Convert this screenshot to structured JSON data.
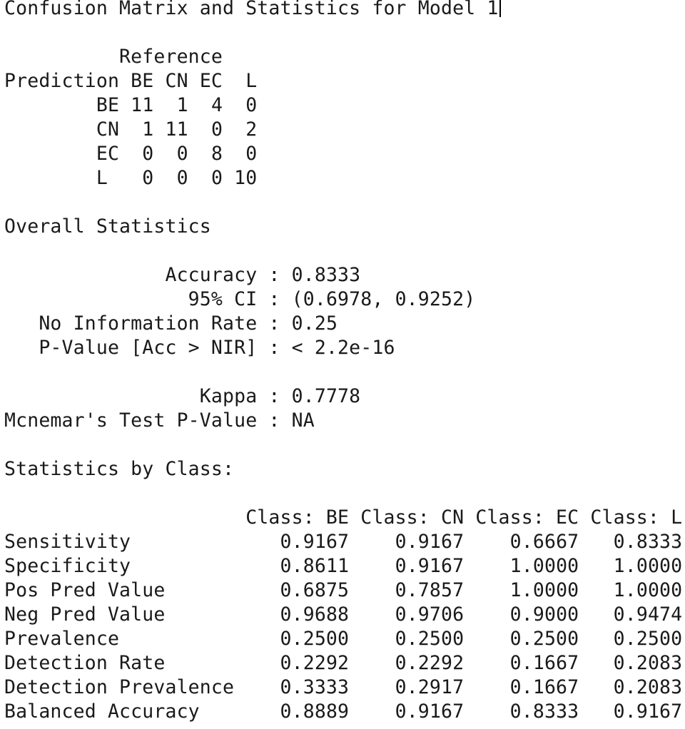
{
  "title": "Confusion Matrix and Statistics for Model 1",
  "confusion_matrix": {
    "reference_label": "Reference",
    "prediction_label": "Prediction",
    "classes": [
      "BE",
      "CN",
      "EC",
      "L"
    ],
    "rows": [
      {
        "label": "BE",
        "values": [
          11,
          1,
          4,
          0
        ]
      },
      {
        "label": "CN",
        "values": [
          1,
          11,
          0,
          2
        ]
      },
      {
        "label": "EC",
        "values": [
          0,
          0,
          8,
          0
        ]
      },
      {
        "label": "L",
        "values": [
          0,
          0,
          0,
          10
        ]
      }
    ]
  },
  "overall_statistics": {
    "heading": "Overall Statistics",
    "group1": [
      {
        "name": "Accuracy",
        "value": "0.8333"
      },
      {
        "name": "95% CI",
        "value": "(0.6978, 0.9252)"
      },
      {
        "name": "No Information Rate",
        "value": "0.25"
      },
      {
        "name": "P-Value [Acc > NIR]",
        "value": "< 2.2e-16"
      }
    ],
    "group2": [
      {
        "name": "Kappa",
        "value": "0.7778"
      },
      {
        "name": "Mcnemar's Test P-Value",
        "value": "NA"
      }
    ]
  },
  "class_statistics": {
    "heading": "Statistics by Class:",
    "columns": [
      "Class: BE",
      "Class: CN",
      "Class: EC",
      "Class: L"
    ],
    "rows": [
      {
        "metric": "Sensitivity",
        "values": [
          "0.9167",
          "0.9167",
          "0.6667",
          "0.8333"
        ]
      },
      {
        "metric": "Specificity",
        "values": [
          "0.8611",
          "0.9167",
          "1.0000",
          "1.0000"
        ]
      },
      {
        "metric": "Pos Pred Value",
        "values": [
          "0.6875",
          "0.7857",
          "1.0000",
          "1.0000"
        ]
      },
      {
        "metric": "Neg Pred Value",
        "values": [
          "0.9688",
          "0.9706",
          "0.9000",
          "0.9474"
        ]
      },
      {
        "metric": "Prevalence",
        "values": [
          "0.2500",
          "0.2500",
          "0.2500",
          "0.2500"
        ]
      },
      {
        "metric": "Detection Rate",
        "values": [
          "0.2292",
          "0.2292",
          "0.1667",
          "0.2083"
        ]
      },
      {
        "metric": "Detection Prevalence",
        "values": [
          "0.3333",
          "0.2917",
          "0.1667",
          "0.2083"
        ]
      },
      {
        "metric": "Balanced Accuracy",
        "values": [
          "0.8889",
          "0.9167",
          "0.8333",
          "0.9167"
        ]
      }
    ]
  }
}
